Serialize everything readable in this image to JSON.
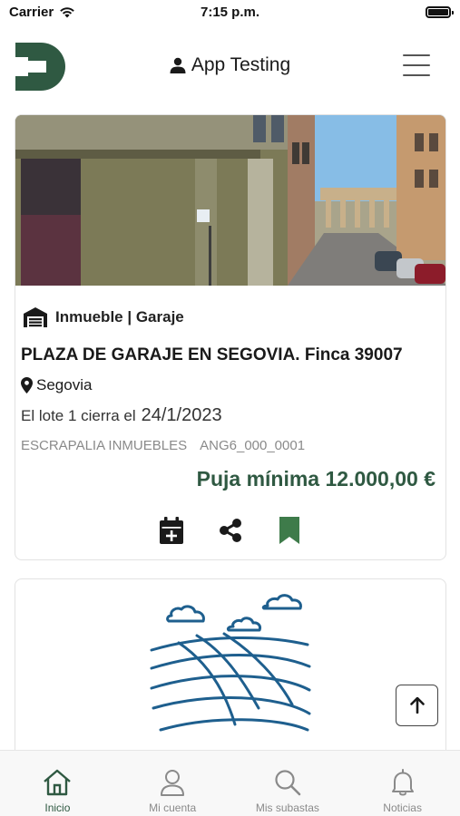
{
  "status_bar": {
    "carrier": "Carrier",
    "time": "7:15 p.m."
  },
  "header": {
    "profile_name": "App Testing",
    "logo_icon": "logo-d-icon",
    "menu_icon": "hamburger-icon"
  },
  "listing": {
    "category": "Inmueble | Garaje",
    "title": "PLAZA DE GARAJE EN SEGOVIA. Finca 39007",
    "location": "Segovia",
    "lot_text": "El lote 1  cierra el",
    "close_date": "24/1/2023",
    "company": "ESCRAPALIA INMUEBLES",
    "reference": "ANG6_000_0001",
    "min_bid": "Puja mínima 12.000,00 €",
    "actions": [
      "add-calendar-icon",
      "share-icon",
      "bookmark-icon"
    ]
  },
  "tabs": [
    {
      "label": "Inicio",
      "icon": "home-icon",
      "active": true
    },
    {
      "label": "Mi cuenta",
      "icon": "user-icon",
      "active": false
    },
    {
      "label": "Mis subastas",
      "icon": "search-icon",
      "active": false
    },
    {
      "label": "Noticias",
      "icon": "bell-icon",
      "active": false
    }
  ],
  "colors": {
    "brand_green": "#2f5942",
    "bookmark_green": "#3e7b4a",
    "landscape_blue": "#1e5f8e",
    "tab_inactive": "#8a8a8a"
  }
}
